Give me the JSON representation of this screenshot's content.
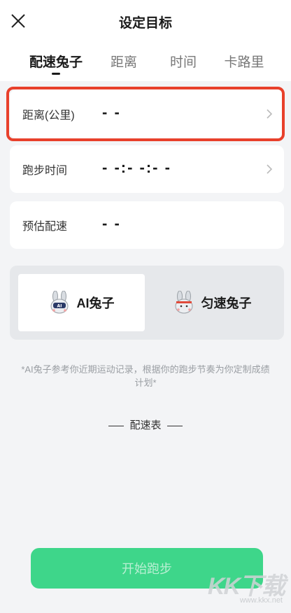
{
  "header": {
    "title": "设定目标",
    "close_icon": "close-icon"
  },
  "tabs": [
    {
      "label": "配速兔子",
      "active": true
    },
    {
      "label": "距离",
      "active": false
    },
    {
      "label": "时间",
      "active": false
    },
    {
      "label": "卡路里",
      "active": false
    }
  ],
  "fields": {
    "distance": {
      "label": "距离(公里)",
      "value": "- -"
    },
    "time": {
      "label": "跑步时间",
      "value": "- -:- -:- -"
    },
    "pace": {
      "label": "预估配速",
      "value": "- -"
    }
  },
  "modes": {
    "ai": {
      "label": "AI兔子",
      "selected": true,
      "icon": "ai-rabbit-icon"
    },
    "steady": {
      "label": "匀速兔子",
      "selected": false,
      "icon": "steady-rabbit-icon"
    }
  },
  "note": "*AI兔子参考你近期运动记录，根据你的跑步节奏为你定制成绩计划*",
  "pace_table": {
    "title": "配速表"
  },
  "start_button": {
    "label": "开始跑步"
  },
  "watermark": {
    "text": "KK下载",
    "url": "www.kkx.net"
  },
  "colors": {
    "accent_green": "#3ed68a",
    "highlight_red": "#e8402b",
    "background": "#f3f4f6"
  }
}
